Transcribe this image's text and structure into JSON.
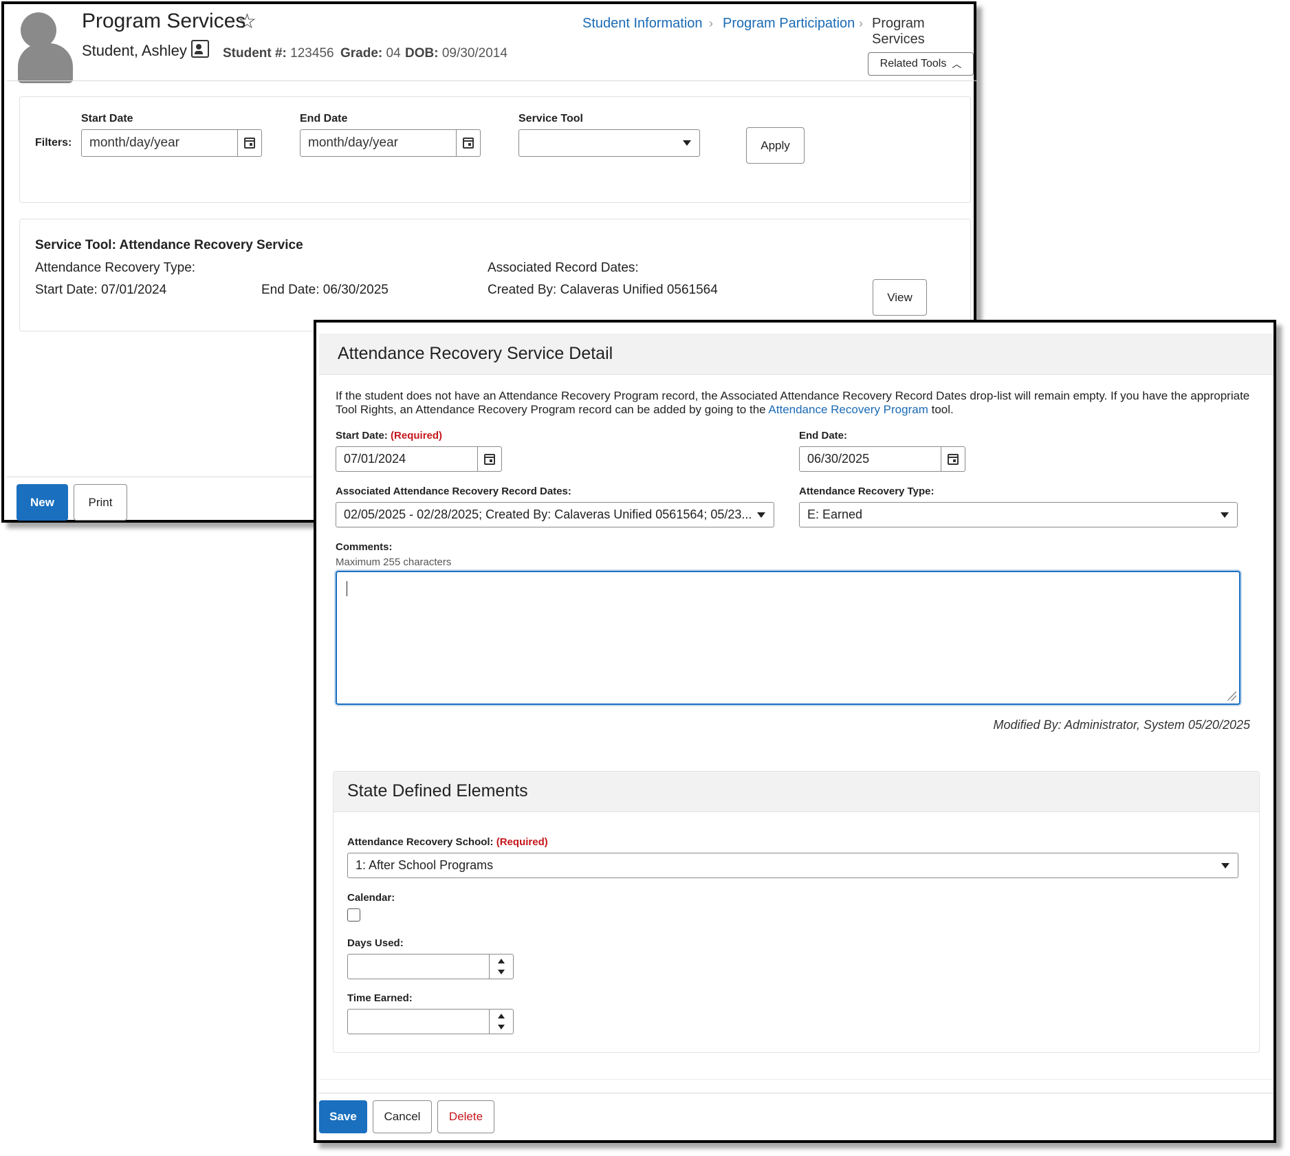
{
  "header": {
    "title": "Program Services",
    "student_name": "Student, Ashley",
    "student_num_label": "Student #:",
    "student_num": "123456",
    "grade_label": "Grade:",
    "grade": "04",
    "dob_label": "DOB:",
    "dob": "09/30/2014",
    "related_tools": "Related Tools"
  },
  "breadcrumb": [
    "Student Information",
    "Program Participation",
    "Program Services"
  ],
  "filters": {
    "label": "Filters:",
    "start_label": "Start Date",
    "start_placeholder": "month/day/year",
    "end_label": "End Date",
    "end_placeholder": "month/day/year",
    "tool_label": "Service Tool",
    "tool_value": "",
    "apply": "Apply"
  },
  "service": {
    "title": "Service Tool: Attendance Recovery Service",
    "type": "Attendance Recovery Type:",
    "assoc": "Associated Record Dates:",
    "start": "Start Date: 07/01/2024",
    "end": "End Date: 06/30/2025",
    "created": "Created By: Calaveras Unified 0561564",
    "view": "View"
  },
  "footer1": {
    "new": "New",
    "print": "Print"
  },
  "detail": {
    "title": "Attendance Recovery Service Detail",
    "info_text": "If the student does not have an Attendance Recovery Program record, the Associated Attendance Recovery Record Dates drop-list will remain empty. If you have the appropriate Tool Rights, an Attendance Recovery Program record can be added by going to the",
    "info_link": "Attendance Recovery Program",
    "info_tail": "tool.",
    "start_label": "Start Date:",
    "required": "(Required)",
    "start_value": "07/01/2024",
    "end_label": "End Date:",
    "end_value": "06/30/2025",
    "assoc_label": "Associated Attendance Recovery Record Dates:",
    "assoc_value": "02/05/2025 - 02/28/2025; Created By: Calaveras Unified 0561564; 05/23...",
    "type_label": "Attendance Recovery Type:",
    "type_value": "E: Earned",
    "comments_label": "Comments:",
    "comments_hint": "Maximum 255 characters",
    "comments_value": "",
    "modified": "Modified By: Administrator, System 05/20/2025"
  },
  "sde": {
    "title": "State Defined Elements",
    "school_label": "Attendance Recovery School:",
    "required": "(Required)",
    "school_value": "1: After School Programs",
    "calendar_label": "Calendar:",
    "calendar_checked": false,
    "days_label": "Days Used:",
    "days_value": "",
    "time_label": "Time Earned:",
    "time_value": ""
  },
  "footer2": {
    "save": "Save",
    "cancel": "Cancel",
    "delete": "Delete"
  },
  "colors": {
    "primary": "#1a6fbf",
    "link": "#1a6ab5",
    "required": "#c4161c"
  }
}
